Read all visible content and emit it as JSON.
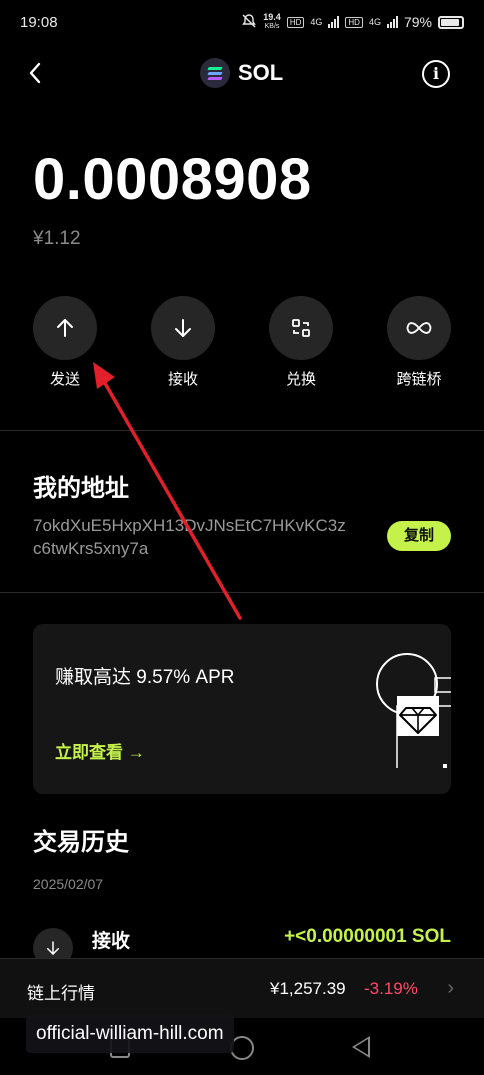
{
  "status_bar": {
    "time": "19:08",
    "net_speed": "19.4",
    "net_unit": "KB/s",
    "hd1": "HD",
    "net1": "4G",
    "hd2": "HD",
    "net2": "4G",
    "battery": "79%"
  },
  "header": {
    "back_icon": "chevron-left-icon",
    "title": "SOL",
    "info_icon": "info-icon"
  },
  "balance": {
    "amount": "0.0008908",
    "fiat": "¥1.12"
  },
  "actions": [
    {
      "label": "发送",
      "icon": "arrow-up-icon"
    },
    {
      "label": "接收",
      "icon": "arrow-down-icon"
    },
    {
      "label": "兑换",
      "icon": "swap-icon"
    },
    {
      "label": "跨链桥",
      "icon": "bridge-icon"
    }
  ],
  "address_section": {
    "title": "我的地址",
    "address": "7okdXuE5HxpXH13DvJNsEtC7HKvKC3zc6twKrs5xny7a",
    "copy_label": "复制"
  },
  "stake_card": {
    "text": "赚取高达 9.57% APR",
    "link": "立即查看 →"
  },
  "history": {
    "title": "交易历史",
    "date": "2025/02/07",
    "items": [
      {
        "label": "接收",
        "amount": "+<0.00000001 SOL"
      }
    ]
  },
  "market": {
    "label": "链上行情",
    "price": "¥1,257.39",
    "change": "-3.19%"
  },
  "watermark": "official-william-hill.com",
  "colors": {
    "accent": "#c5f24a",
    "negative": "#ff4a6b",
    "annotation": "#e0202a"
  }
}
